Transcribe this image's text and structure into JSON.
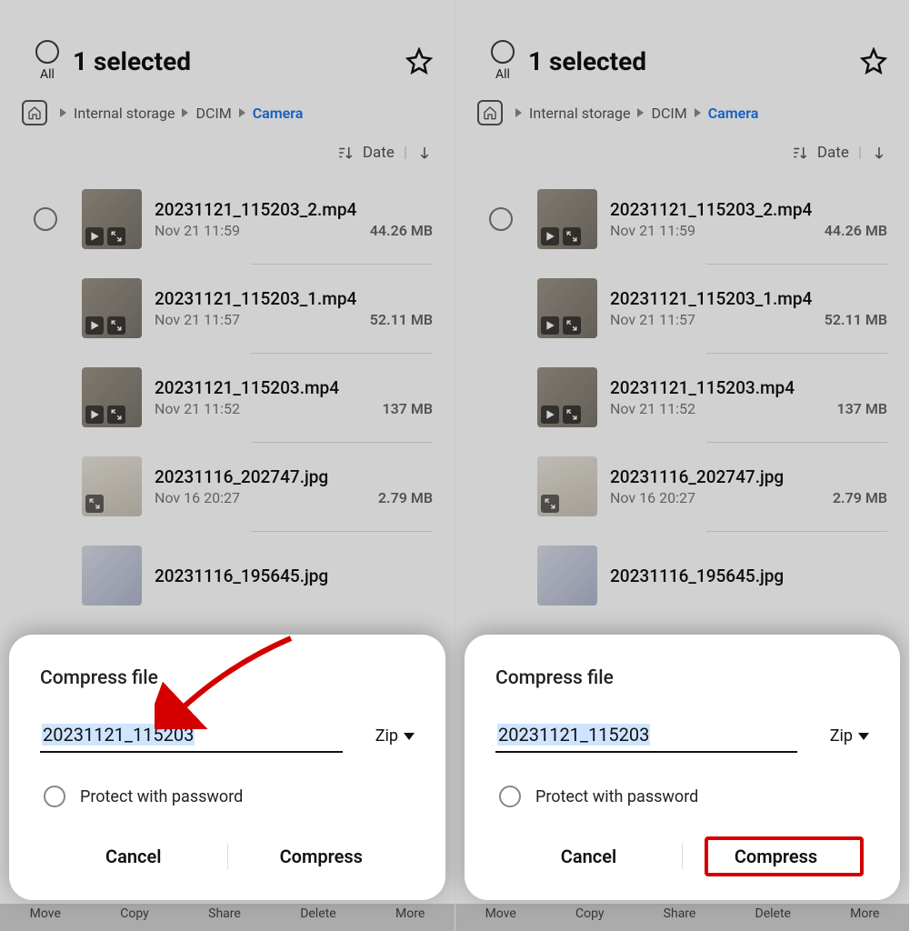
{
  "header": {
    "title": "1 selected",
    "all_label": "All"
  },
  "breadcrumb": {
    "items": [
      "Internal storage",
      "DCIM",
      "Camera"
    ]
  },
  "sort": {
    "label": "Date"
  },
  "files": [
    {
      "name": "20231121_115203_2.mp4",
      "date": "Nov 21 11:59",
      "size": "44.26 MB",
      "type": "video",
      "selected": false
    },
    {
      "name": "20231121_115203_1.mp4",
      "date": "Nov 21 11:57",
      "size": "52.11 MB",
      "type": "video",
      "selected": false
    },
    {
      "name": "20231121_115203.mp4",
      "date": "Nov 21 11:52",
      "size": "137 MB",
      "type": "video",
      "selected": true
    },
    {
      "name": "20231116_202747.jpg",
      "date": "Nov 16 20:27",
      "size": "2.79 MB",
      "type": "image",
      "selected": false
    },
    {
      "name": "20231116_195645.jpg",
      "date": "",
      "size": "",
      "type": "image",
      "selected": false
    }
  ],
  "sheet": {
    "title": "Compress file",
    "value": "20231121_115203",
    "format": "Zip",
    "password_label": "Protect with password",
    "cancel_label": "Cancel",
    "confirm_label": "Compress"
  },
  "bottombar": {
    "items": [
      "Move",
      "Copy",
      "Share",
      "Delete",
      "More"
    ]
  }
}
